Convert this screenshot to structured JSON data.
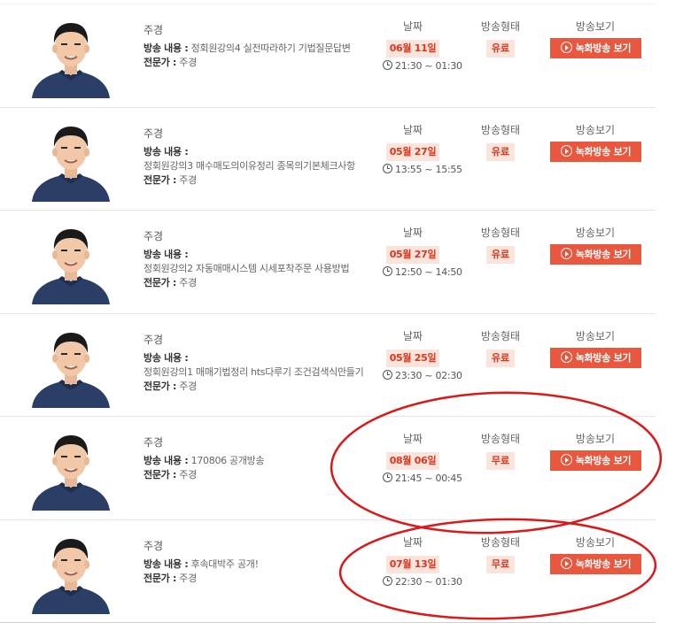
{
  "columns": {
    "date": "날짜",
    "type": "방송형태",
    "watch": "방송보기"
  },
  "labels": {
    "content": "방송 내용 :",
    "expert": "전문가 :",
    "expert_sep": " "
  },
  "accent_color": "#e9573e",
  "badge_bg": "#fbe4dc",
  "annotation_color": "#d91a1a",
  "items": [
    {
      "name": "주경",
      "content": "정회원강의4 실전따라하기 기법질문답변",
      "content_inline": true,
      "expert": "주경",
      "date": "06월 11일",
      "time": "21:30 ~ 01:30",
      "type": "유료",
      "button": "녹화방송 보기"
    },
    {
      "name": "주경",
      "content": "정회원강의3 매수매도의이유정리 종목의기본체크사항",
      "content_inline": false,
      "expert": "주경",
      "date": "05월 27일",
      "time": "13:55 ~ 15:55",
      "type": "유료",
      "button": "녹화방송 보기"
    },
    {
      "name": "주경",
      "content": "정회원강의2 자동매매시스템 시세포착주문 사용방법",
      "content_inline": false,
      "expert": "주경",
      "date": "05월 27일",
      "time": "12:50 ~ 14:50",
      "type": "유료",
      "button": "녹화방송 보기"
    },
    {
      "name": "주경",
      "content": "정회원강의1 매매기법정리 hts다루기 조건검색식만들기",
      "content_inline": false,
      "expert": "주경",
      "date": "05월 25일",
      "time": "23:30 ~ 02:30",
      "type": "유료",
      "button": "녹화방송 보기"
    },
    {
      "name": "주경",
      "content": "170806 공개방송",
      "content_inline": true,
      "expert": "주경",
      "date": "08월 06일",
      "time": "21:45 ~ 00:45",
      "type": "무료",
      "button": "녹화방송 보기"
    },
    {
      "name": "주경",
      "content": "후속대박주 공개!",
      "content_inline": true,
      "expert": "주경",
      "date": "07월 13일",
      "time": "22:30 ~ 01:30",
      "type": "무료",
      "button": "녹화방송 보기"
    }
  ]
}
